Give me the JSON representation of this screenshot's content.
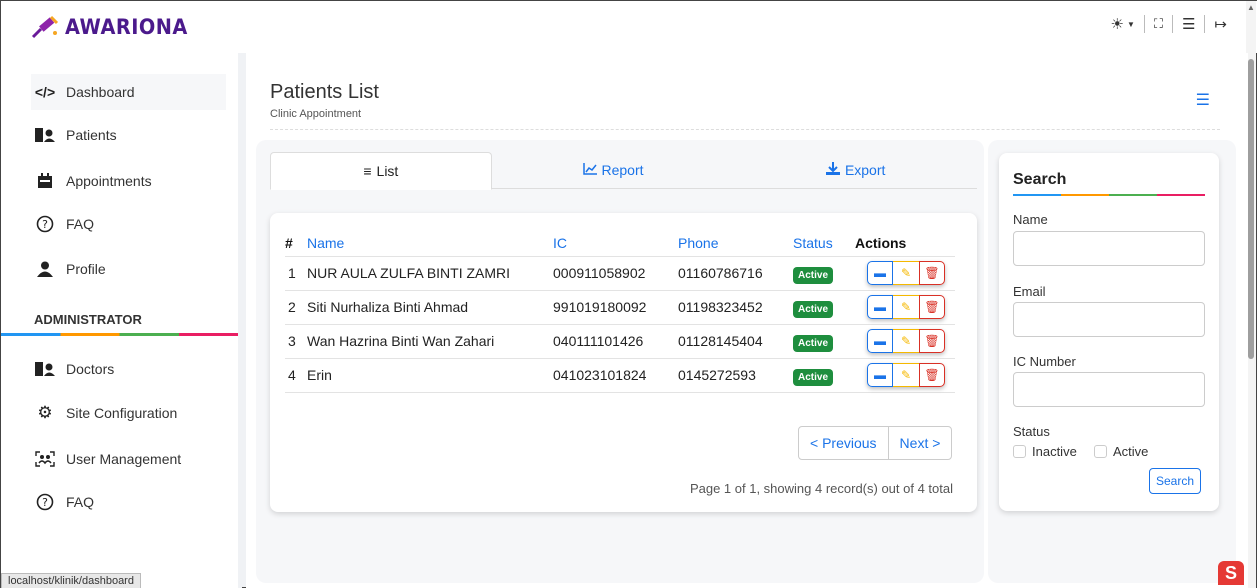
{
  "brand": {
    "name": "AWARIONA"
  },
  "topbar": {
    "theme_icon": "sun-icon",
    "fullscreen_icon": "fullscreen-icon",
    "menu_icon": "align-icon",
    "logout_icon": "logout-icon"
  },
  "sidebar": {
    "items": [
      {
        "label": "Dashboard",
        "icon": "code-icon"
      },
      {
        "label": "Patients",
        "icon": "patients-icon"
      },
      {
        "label": "Appointments",
        "icon": "calendar-icon"
      },
      {
        "label": "FAQ",
        "icon": "question-icon"
      },
      {
        "label": "Profile",
        "icon": "user-icon"
      }
    ],
    "section_title": "ADMINISTRATOR",
    "admin_items": [
      {
        "label": "Doctors",
        "icon": "doctors-icon"
      },
      {
        "label": "Site Configuration",
        "icon": "gear-icon"
      },
      {
        "label": "User Management",
        "icon": "users-scan-icon"
      },
      {
        "label": "FAQ",
        "icon": "question-icon"
      }
    ]
  },
  "statusbar": {
    "url": "localhost/klinik/dashboard"
  },
  "page": {
    "title": "Patients List",
    "subtitle": "Clinic Appointment"
  },
  "tabs": [
    {
      "label": "List",
      "icon": "list-icon"
    },
    {
      "label": "Report",
      "icon": "chart-icon"
    },
    {
      "label": "Export",
      "icon": "download-icon"
    }
  ],
  "table": {
    "headers": [
      "#",
      "Name",
      "IC",
      "Phone",
      "Status",
      "Actions"
    ],
    "rows": [
      {
        "no": "1",
        "name": "NUR AULA ZULFA BINTI ZAMRI",
        "ic": "000911058902",
        "phone": "01160786716",
        "status": "Active"
      },
      {
        "no": "2",
        "name": "Siti Nurhaliza Binti Ahmad",
        "ic": "991019180092",
        "phone": "01198323452",
        "status": "Active"
      },
      {
        "no": "3",
        "name": "Wan Hazrina Binti Wan Zahari",
        "ic": "040111101426",
        "phone": "01128145404",
        "status": "Active"
      },
      {
        "no": "4",
        "name": "Erin",
        "ic": "041023101824",
        "phone": "0145272593",
        "status": "Active"
      }
    ]
  },
  "pagination": {
    "prev": "< Previous",
    "next": "Next >",
    "info": "Page 1 of 1, showing 4 record(s) out of 4 total"
  },
  "search": {
    "title": "Search",
    "name_label": "Name",
    "email_label": "Email",
    "ic_label": "IC Number",
    "status_label": "Status",
    "inactive_label": "Inactive",
    "active_label": "Active",
    "button": "Search"
  },
  "colors": {
    "accent": "#1a73e8",
    "brand": "#4b1a8c",
    "active_badge": "#1e8e3e"
  }
}
